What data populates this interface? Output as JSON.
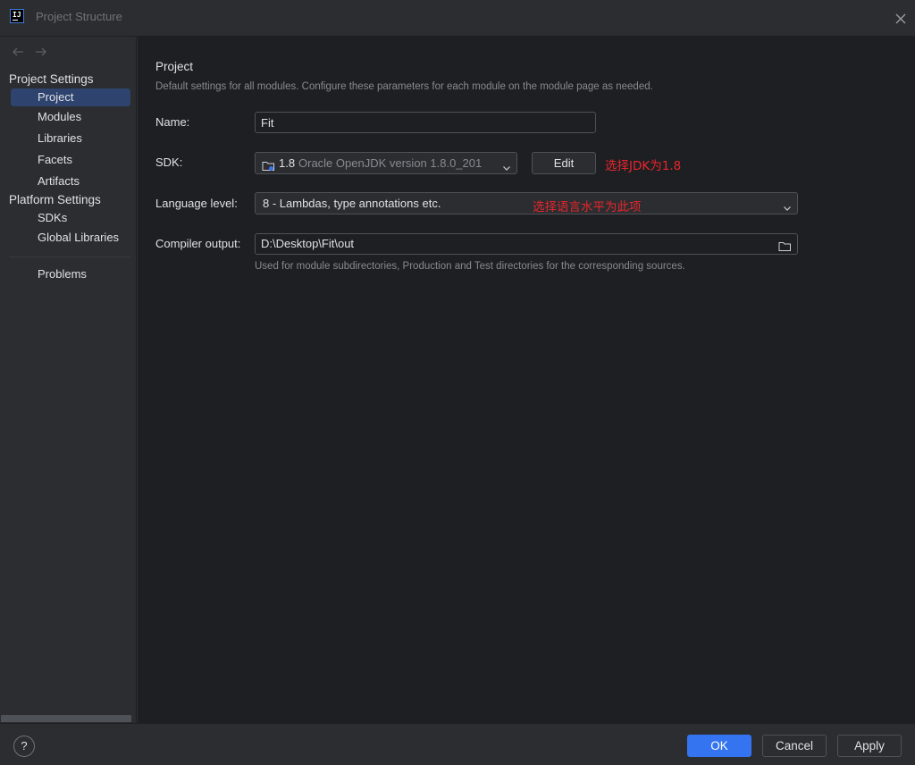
{
  "window": {
    "title": "Project Structure",
    "logo_text": "IJ"
  },
  "sidebar": {
    "groups": [
      {
        "title": "Project Settings",
        "items": [
          "Project",
          "Modules",
          "Libraries",
          "Facets",
          "Artifacts"
        ]
      },
      {
        "title": "Platform Settings",
        "items": [
          "SDKs",
          "Global Libraries"
        ]
      }
    ],
    "selected": "Project",
    "problems": "Problems"
  },
  "main": {
    "title": "Project",
    "description": "Default settings for all modules. Configure these parameters for each module on the module page as needed.",
    "name_label": "Name:",
    "name_value": "Fit",
    "sdk_label": "SDK:",
    "sdk_version": "1.8",
    "sdk_name": "Oracle OpenJDK version 1.8.0_201",
    "edit_label": "Edit",
    "sdk_annotation": "选择JDK为1.8",
    "language_label": "Language level:",
    "language_value": "8 - Lambdas, type annotations etc.",
    "language_annotation": "选择语言水平为此项",
    "compiler_label": "Compiler output:",
    "compiler_value": "D:\\Desktop\\Fit\\out",
    "compiler_hint": "Used for module subdirectories, Production and Test directories for the corresponding sources."
  },
  "footer": {
    "help": "?",
    "ok": "OK",
    "cancel": "Cancel",
    "apply": "Apply"
  },
  "colors": {
    "accent": "#3574f0",
    "selection": "#2e436e",
    "annotation": "#e8262d"
  }
}
